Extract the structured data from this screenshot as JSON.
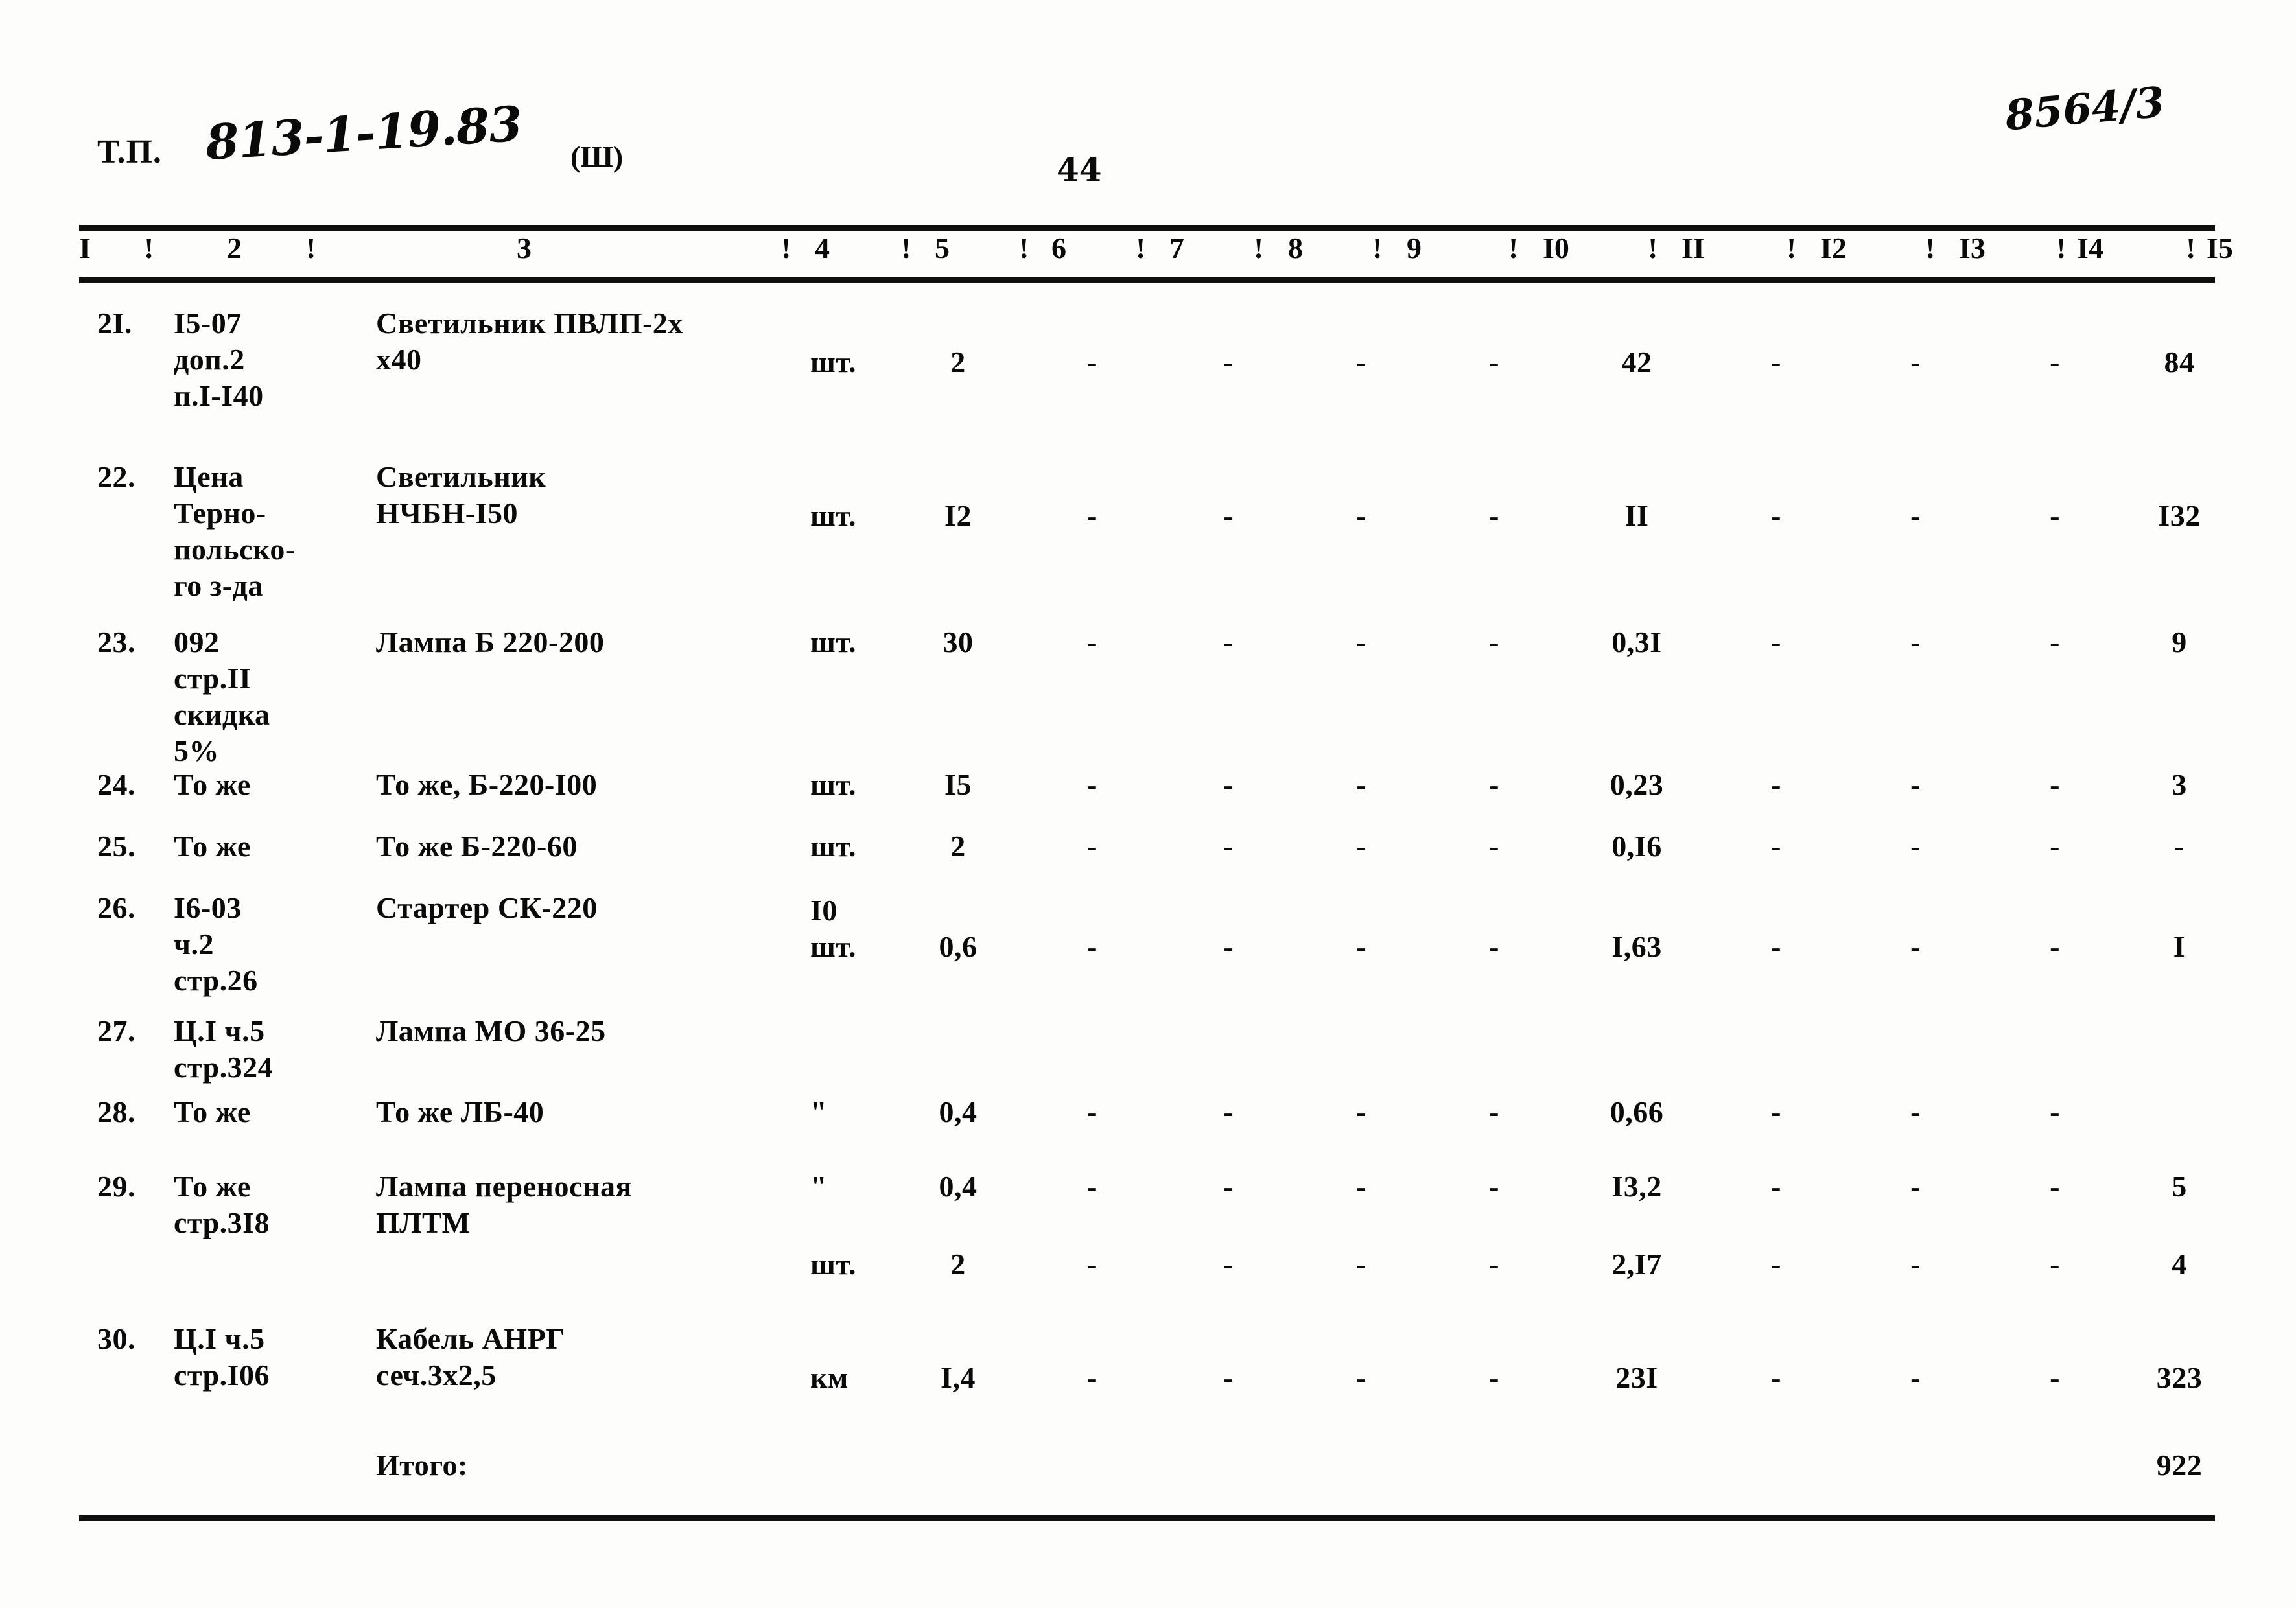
{
  "header": {
    "tp_label": "Т.П.",
    "tp_code": "813-1-19.83",
    "sheet_mark": "(Ш)",
    "page_number": "44",
    "archive_code": "8564/3"
  },
  "table": {
    "column_headers": [
      "I",
      "2",
      "3",
      "4",
      "5",
      "6",
      "7",
      "8",
      "9",
      "I0",
      "II",
      "I2",
      "I3",
      "I4",
      "I5"
    ],
    "header_separator": "!",
    "rows": [
      {
        "no": "2I.",
        "ref_lines": [
          "I5-07",
          "доп.2",
          "п.I-I40"
        ],
        "name_lines": [
          "Светильник ПВЛП-2х",
          "х40"
        ],
        "unit": "шт.",
        "c4": "2",
        "c5": "-",
        "c6": "-",
        "c7": "-",
        "c8": "-",
        "c9": "42",
        "c10": "-",
        "c11": "-",
        "c12": "-",
        "c13": "84",
        "c14": "-",
        "c15": "-"
      },
      {
        "no": "22.",
        "ref_lines": [
          "Цена",
          "Терно-",
          "польско-",
          "го з-да"
        ],
        "name_lines": [
          "Светильник",
          "НЧБН-I50"
        ],
        "unit": "шт.",
        "c4": "I2",
        "c5": "-",
        "c6": "-",
        "c7": "-",
        "c8": "-",
        "c9": "II",
        "c10": "-",
        "c11": "-",
        "c12": "-",
        "c13": "I32",
        "c14": "-",
        "c15": "-"
      },
      {
        "no": "23.",
        "ref_lines": [
          "092",
          "стр.II",
          "скидка",
          "5%"
        ],
        "name_lines": [
          "Лампа Б 220-200"
        ],
        "unit": "шт.",
        "c4": "30",
        "c5": "-",
        "c6": "-",
        "c7": "-",
        "c8": "-",
        "c9": "0,3I",
        "c10": "-",
        "c11": "-",
        "c12": "-",
        "c13": "9",
        "c14": "-",
        "c15": "-"
      },
      {
        "no": "24.",
        "ref_lines": [
          "То же"
        ],
        "name_lines": [
          "То же, Б-220-I00"
        ],
        "unit": "шт.",
        "c4": "I5",
        "c5": "-",
        "c6": "-",
        "c7": "-",
        "c8": "-",
        "c9": "0,23",
        "c10": "-",
        "c11": "-",
        "c12": "-",
        "c13": "3",
        "c14": "-",
        "c15": "-"
      },
      {
        "no": "25.",
        "ref_lines": [
          "То же"
        ],
        "name_lines": [
          "То же Б-220-60"
        ],
        "unit": "шт.",
        "c4": "2",
        "c5": "-",
        "c6": "-",
        "c7": "-",
        "c8": "-",
        "c9": "0,I6",
        "c10": "-",
        "c11": "-",
        "c12": "-",
        "c13": "-",
        "c14": "-",
        "c15": "-"
      },
      {
        "no": "26.",
        "ref_lines": [
          "I6-03",
          "ч.2",
          "стр.26"
        ],
        "name_lines": [
          "Стартер СК-220"
        ],
        "unit_prefix": "I0",
        "unit": "шт.",
        "c4": "0,6",
        "c5": "-",
        "c6": "-",
        "c7": "-",
        "c8": "-",
        "c9": "I,63",
        "c10": "-",
        "c11": "-",
        "c12": "-",
        "c13": "I",
        "c14": "-",
        "c15": "-"
      },
      {
        "no": "27.",
        "ref_lines": [
          "Ц.I ч.5",
          "стр.324"
        ],
        "name_lines": [
          "Лампа МО 36-25"
        ],
        "unit": "\"",
        "c4": "0,4",
        "c5": "-",
        "c6": "-",
        "c7": "-",
        "c8": "-",
        "c9": "0,66",
        "c10": "-",
        "c11": "-",
        "c12": "-",
        "c13": "",
        "c14": "-",
        "c15": "-"
      },
      {
        "no": "28.",
        "ref_lines": [
          "То же"
        ],
        "name_lines": [
          "То же ЛБ-40"
        ],
        "unit": "\"",
        "c4": "0,4",
        "c5": "-",
        "c6": "-",
        "c7": "-",
        "c8": "-",
        "c9": "I3,2",
        "c10": "-",
        "c11": "-",
        "c12": "-",
        "c13": "5",
        "c14": "-",
        "c15": "-"
      },
      {
        "no": "29.",
        "ref_lines": [
          "То же",
          "стр.3I8"
        ],
        "name_lines": [
          "Лампа переносная",
          "ПЛТМ"
        ],
        "unit": "шт.",
        "c4": "2",
        "c5": "-",
        "c6": "-",
        "c7": "-",
        "c8": "-",
        "c9": "2,I7",
        "c10": "-",
        "c11": "-",
        "c12": "-",
        "c13": "4",
        "c14": "-",
        "c15": "-"
      },
      {
        "no": "30.",
        "ref_lines": [
          "Ц.I ч.5",
          "стр.I06"
        ],
        "name_lines": [
          "Кабель АНРГ",
          "сеч.3х2,5"
        ],
        "unit": "км",
        "c4": "I,4",
        "c5": "-",
        "c6": "-",
        "c7": "-",
        "c8": "-",
        "c9": "23I",
        "c10": "-",
        "c11": "-",
        "c12": "-",
        "c13": "323",
        "c14": "-",
        "c15": "-"
      }
    ],
    "total_row": {
      "label": "Итого:",
      "c13": "922",
      "c14": "-",
      "c15": "-"
    }
  }
}
